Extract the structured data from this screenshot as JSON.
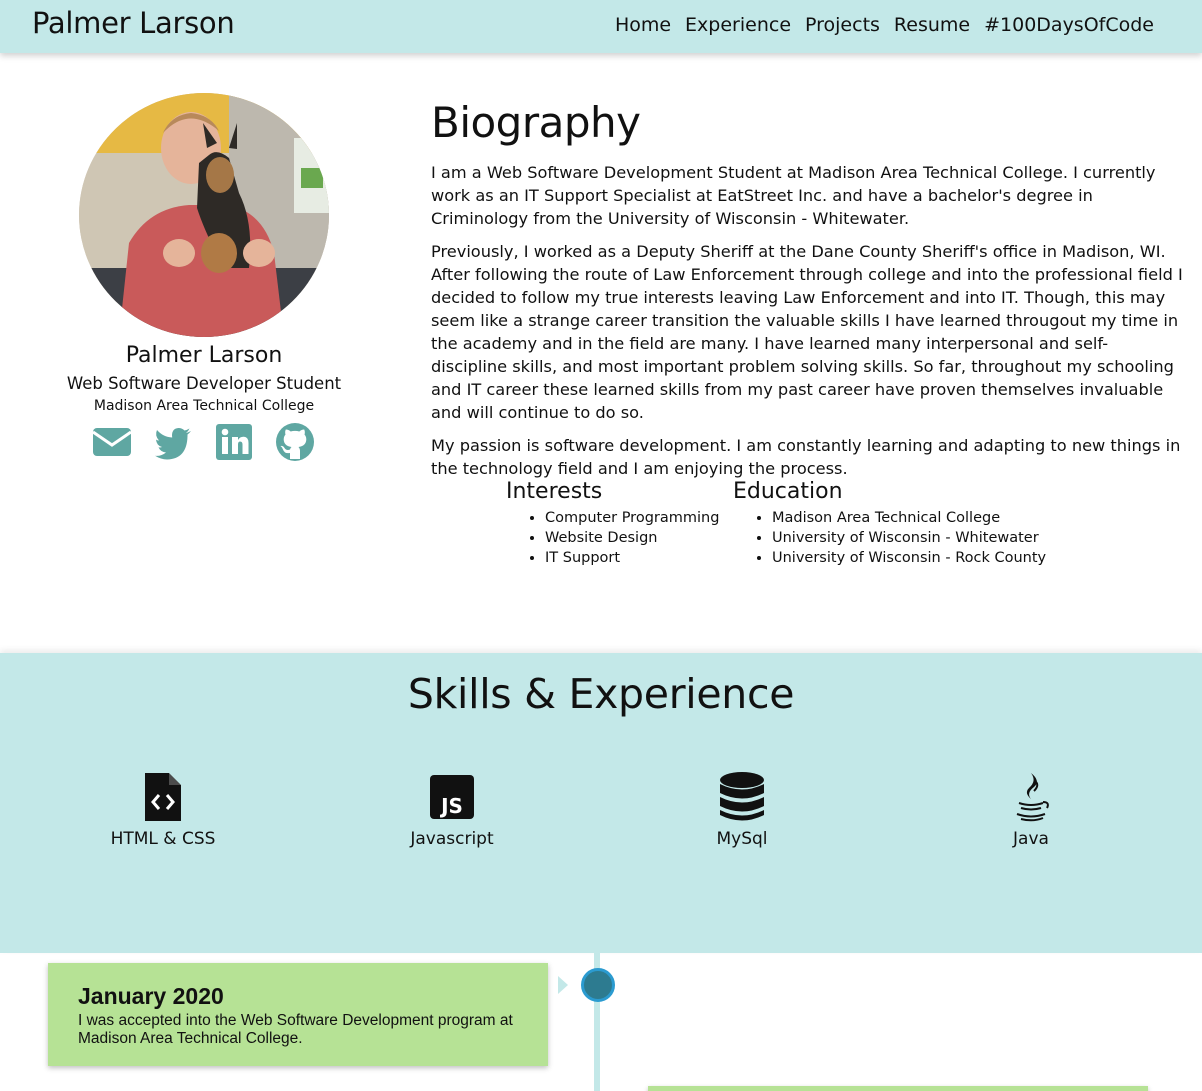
{
  "navbar": {
    "brand": "Palmer Larson",
    "links": [
      "Home",
      "Experience",
      "Projects",
      "Resume",
      "#100DaysOfCode"
    ]
  },
  "profile": {
    "name": "Palmer Larson",
    "role": "Web Software Developer Student",
    "school": "Madison Area Technical College",
    "social_icons": [
      "envelope-icon",
      "twitter-icon",
      "linkedin-icon",
      "github-icon"
    ]
  },
  "biography": {
    "title": "Biography",
    "paragraphs": [
      "I am a Web Software Development Student at Madison Area Technical College. I currently work as an IT Support Specialist at EatStreet Inc. and have a bachelor's degree in Criminology from the University of Wisconsin - Whitewater.",
      "Previously, I worked as a Deputy Sheriff at the Dane County Sheriff's office in Madison, WI. After following the route of Law Enforcement through college and into the professional field I decided to follow my true interests leaving Law Enforcement and into IT. Though, this may seem like a strange career transition the valuable skills I have learned througout my time in the academy and in the field are many. I have learned many interpersonal and self-discipline skills, and most important problem solving skills. So far, throughout my schooling and IT career these learned skills from my past career have proven themselves invaluable and will continue to do so.",
      "My passion is software development. I am constantly learning and adapting to new things in the technology field and I am enjoying the process."
    ]
  },
  "interests": {
    "title": "Interests",
    "items": [
      "Computer Programming",
      "Website Design",
      "IT Support"
    ]
  },
  "education": {
    "title": "Education",
    "items": [
      "Madison Area Technical College",
      "University of Wisconsin - Whitewater",
      "University of Wisconsin - Rock County"
    ]
  },
  "skills": {
    "title": "Skills & Experience",
    "items": [
      {
        "label": "HTML & CSS",
        "icon": "file-code-icon"
      },
      {
        "label": "Javascript",
        "icon": "js-icon"
      },
      {
        "label": "MySql",
        "icon": "database-icon"
      },
      {
        "label": "Java",
        "icon": "java-icon"
      }
    ]
  },
  "timeline": [
    {
      "date": "January 2020",
      "text": "I was accepted into the Web Software Development program at Madison Area Technical College."
    }
  ],
  "colors": {
    "accent_bg": "#c3e8e8",
    "icon_teal": "#5fa7a2",
    "timeline_card": "#b6e295",
    "timeline_dot": "#2d7b90"
  }
}
